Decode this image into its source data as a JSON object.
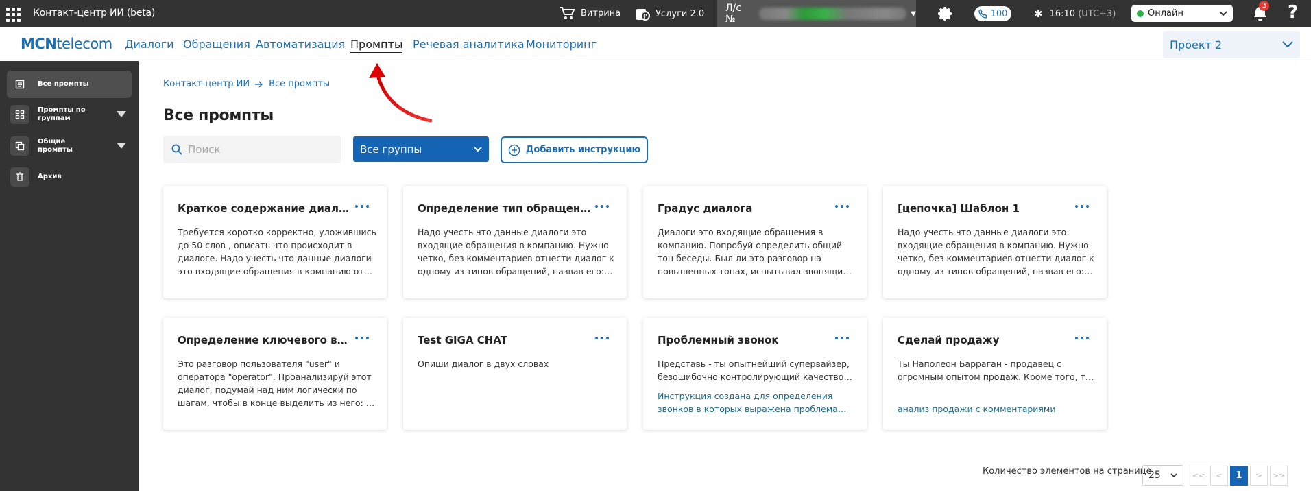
{
  "topbar": {
    "app_title": "Контакт-центр ИИ (beta)",
    "showcase": "Витрина",
    "services": "Услуги 2.0",
    "account_prefix": "Л/с №",
    "phone_count": "100",
    "time": "16:10",
    "timezone": "(UTC+3)",
    "status": "Онлайн",
    "notifications": "3",
    "help": "?"
  },
  "navbar": {
    "logo_bold": "MCN",
    "logo_rest": "telecom",
    "items": [
      "Диалоги",
      "Обращения",
      "Автоматизация",
      "Промпты",
      "Речевая аналитика",
      "Мониторинг"
    ],
    "active": "Промпты",
    "project": "Проект 2"
  },
  "sidebar": {
    "items": [
      {
        "label": "Все промпты",
        "icon": "document-icon"
      },
      {
        "label": "Промпты по группам",
        "icon": "grid-icon"
      },
      {
        "label": "Общие промпты",
        "icon": "copy-icon"
      },
      {
        "label": "Архив",
        "icon": "archive-icon"
      }
    ]
  },
  "breadcrumb": {
    "root": "Контакт-центр ИИ",
    "current": "Все промпты"
  },
  "page": {
    "title": "Все промпты",
    "search_placeholder": "Поиск",
    "groups_label": "Все группы",
    "add_label": "Добавить инструкцию"
  },
  "cards": [
    {
      "title": "Краткое содержание диалога",
      "text": "Требуется коротко корректно, уложившись до 50 слов , описать что происходит в диалоге. Надо учесть что данные диалоги это входящие обращения в компанию от клиентов",
      "note": ""
    },
    {
      "title": "Определение тип обращения",
      "text": "Надо учесть что данные диалоги это входящие обращения в компанию. Нужно четко, без комментариев отнести диалог к одному из типов обращений, назвав его: консультация",
      "note": ""
    },
    {
      "title": "Градус диалога",
      "text": "Диалоги это входящие обращения в компанию. Попробуй определить общий тон беседы. Был ли это разговор на повышенных тонах, испытывал звонящий раздражение",
      "note": ""
    },
    {
      "title": "[цепочка] Шаблон 1",
      "text": "Надо учесть что данные диалоги это входящие обращения в компанию. Нужно четко, без комментариев отнести диалог к одному из типов обращений, назвав его: консультация",
      "note": ""
    },
    {
      "title": "Определение ключевого вопроса",
      "text": "Это разговор пользователя \"user\" и оператора \"operator\". Проанализируй этот диалог, подумай над ним логически по шагам, чтобы в конце выделить из него: - ключевой вопрос",
      "note": ""
    },
    {
      "title": "Test GIGA CHAT",
      "text": "Опиши диалог в двух словах",
      "note": ""
    },
    {
      "title": "Проблемный звонок",
      "text": "Представь - ты опытнейший супервайзер, безошибочно контролирующий качество работы операторов",
      "note": "Инструкция создана для определения звонков в которых выражена проблема клиента"
    },
    {
      "title": "Сделай продажу",
      "text": "Ты Наполеон Барраган - продавец с огромным опытом продаж. Кроме того, ты эксперт",
      "note": "анализ продажи с комментариями"
    }
  ],
  "pagination": {
    "per_page_label": "Количество элементов на странице",
    "per_page": "25",
    "first": "<<",
    "prev": "<",
    "current": "1",
    "next": ">",
    "last": ">>"
  }
}
